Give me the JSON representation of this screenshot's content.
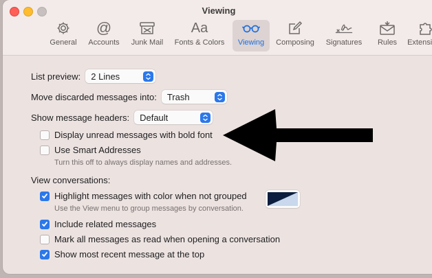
{
  "window": {
    "title": "Viewing"
  },
  "toolbar": {
    "items": [
      {
        "label": "General",
        "icon": "gear-icon",
        "selected": false
      },
      {
        "label": "Accounts",
        "icon": "at-sign-icon",
        "selected": false
      },
      {
        "label": "Junk Mail",
        "icon": "junk-mail-icon",
        "selected": false
      },
      {
        "label": "Fonts & Colors",
        "icon_text": "Aa",
        "icon": "fonts-icon",
        "selected": false
      },
      {
        "label": "Viewing",
        "icon": "glasses-icon",
        "selected": true
      },
      {
        "label": "Composing",
        "icon": "compose-icon",
        "selected": false
      },
      {
        "label": "Signatures",
        "icon": "signature-icon",
        "selected": false
      },
      {
        "label": "Rules",
        "icon": "rules-icon",
        "selected": false
      },
      {
        "label": "Extensions",
        "icon": "puzzle-icon",
        "selected": false
      }
    ],
    "accent_color": "#1e6fe0"
  },
  "settings": {
    "list_preview": {
      "label": "List preview:",
      "value": "2 Lines"
    },
    "move_discarded": {
      "label": "Move discarded messages into:",
      "value": "Trash"
    },
    "show_headers": {
      "label": "Show message headers:",
      "value": "Default"
    },
    "bold_unread": {
      "label": "Display unread messages with bold font",
      "checked": false
    },
    "smart_addresses": {
      "label": "Use Smart Addresses",
      "checked": false,
      "help": "Turn this off to always display names and addresses."
    },
    "view_conversations_heading": "View conversations:",
    "highlight_color": {
      "label": "Highlight messages with color when not grouped",
      "checked": true,
      "help": "Use the View menu to group messages by conversation.",
      "swatch_colors": [
        "#0b1e3d",
        "#c9d8ec"
      ]
    },
    "include_related": {
      "label": "Include related messages",
      "checked": true
    },
    "mark_all_read": {
      "label": "Mark all messages as read when opening a conversation",
      "checked": false
    },
    "most_recent_top": {
      "label": "Show most recent message at the top",
      "checked": true
    }
  },
  "annotation": {
    "arrow_color": "#000000",
    "points_to": "bold_unread"
  }
}
